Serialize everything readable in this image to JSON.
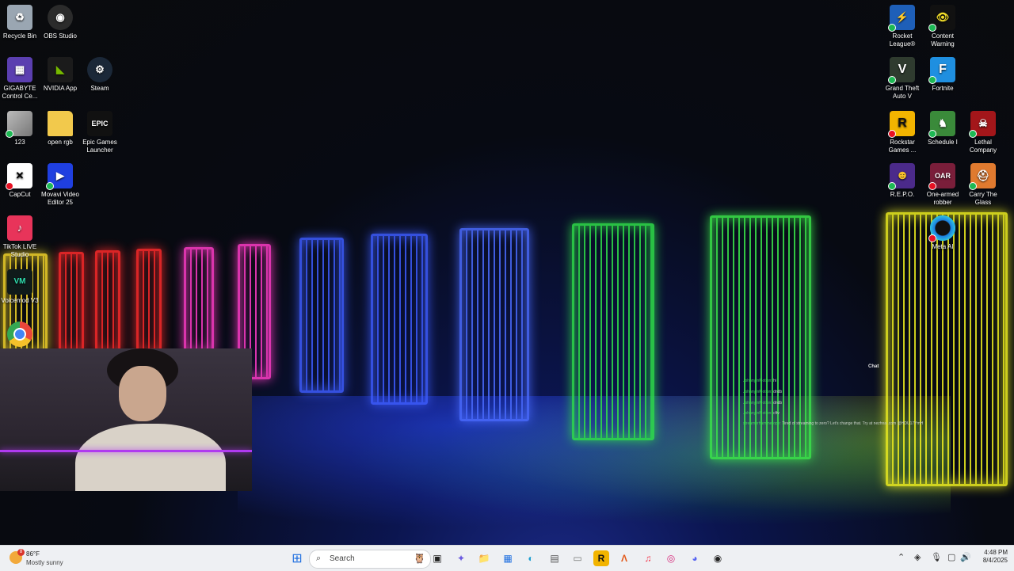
{
  "desktop_icons_left": [
    {
      "label": "Recycle Bin",
      "icon": "recycle-bin-icon",
      "color": "#9aa6b2",
      "glyph": "♻",
      "badge": ""
    },
    {
      "label": "OBS Studio",
      "icon": "obs-icon",
      "color": "#2b2b2b",
      "glyph": "◉",
      "badge": ""
    },
    {
      "label": "GIGABYTE Control Ce...",
      "icon": "gigabyte-icon",
      "color": "#5b3fb0",
      "glyph": "▦",
      "badge": ""
    },
    {
      "label": "NVIDIA App",
      "icon": "nvidia-icon",
      "color": "#1b1b1b",
      "glyph": "◣",
      "badge": ""
    },
    {
      "label": "Steam",
      "icon": "steam-icon",
      "color": "#1b2838",
      "glyph": "⚙",
      "badge": ""
    },
    {
      "label": "123",
      "icon": "image-file-icon",
      "color": "#8c8c8c",
      "glyph": "",
      "badge": "ok"
    },
    {
      "label": "open rgb",
      "icon": "folder-icon",
      "color": "#f2c94c",
      "glyph": "",
      "badge": ""
    },
    {
      "label": "Epic Games Launcher",
      "icon": "epic-games-icon",
      "color": "#111111",
      "glyph": "EPIC",
      "badge": ""
    },
    {
      "label": "CapCut",
      "icon": "capcut-icon",
      "color": "#ffffff",
      "glyph": "✕",
      "badge": "x"
    },
    {
      "label": "Movavi Video Editor 25",
      "icon": "movavi-icon",
      "color": "#1f3fe0",
      "glyph": "▶",
      "badge": "ok"
    },
    {
      "label": "TikTok LIVE Studio",
      "icon": "tiktok-icon",
      "color": "#e8345a",
      "glyph": "♪",
      "badge": ""
    },
    {
      "label": "Voicemod V3",
      "icon": "voicemod-icon",
      "color": "#0f1a1a",
      "glyph": "VM",
      "badge": ""
    },
    {
      "label": "",
      "icon": "chrome-icon",
      "color": "#e9463a",
      "glyph": "◎",
      "badge": ""
    }
  ],
  "desktop_icons_right": [
    {
      "label": "Rocket League®",
      "icon": "rocket-league-icon",
      "color": "#1e5fb8",
      "glyph": "⚡",
      "badge": "ok"
    },
    {
      "label": "Content Warning",
      "icon": "content-warning-icon",
      "color": "#111111",
      "glyph": "👁",
      "badge": "ok"
    },
    {
      "label": "Grand Theft Auto V",
      "icon": "gta-icon",
      "color": "#2f3b2f",
      "glyph": "V",
      "badge": "ok"
    },
    {
      "label": "Fortnite",
      "icon": "fortnite-icon",
      "color": "#1f8fe0",
      "glyph": "F",
      "badge": "ok"
    },
    {
      "label": "Rockstar Games ...",
      "icon": "rockstar-icon",
      "color": "#f2b400",
      "glyph": "R",
      "badge": "x"
    },
    {
      "label": "Schedule I",
      "icon": "schedule-icon",
      "color": "#3a8a3a",
      "glyph": "♞",
      "badge": "ok"
    },
    {
      "label": "Lethal Company",
      "icon": "lethal-company-icon",
      "color": "#a3161a",
      "glyph": "☠",
      "badge": "ok"
    },
    {
      "label": "R.E.P.O.",
      "icon": "repo-icon",
      "color": "#4b2a8a",
      "glyph": "☻",
      "badge": "ok"
    },
    {
      "label": "One-armed robber",
      "icon": "one-armed-robber-icon",
      "color": "#7a1e3a",
      "glyph": "OAR",
      "badge": "x"
    },
    {
      "label": "Carry The Glass",
      "icon": "carry-the-glass-icon",
      "color": "#e07a2f",
      "glyph": "⛑",
      "badge": "ok"
    },
    {
      "label": "Meta AI",
      "icon": "meta-ai-icon",
      "color": "#1c7fe0",
      "glyph": "◯",
      "badge": "x"
    }
  ],
  "chat_overlay": {
    "title": "Chat",
    "messages": [
      {
        "user": "JohnnyInMotion:",
        "text": "hi"
      },
      {
        "user": "JohnnyInMotion:",
        "text": "dndb"
      },
      {
        "user": "JohnnyInMotion:",
        "text": "dndb"
      },
      {
        "user": "JohnnyInMotion:",
        "text": "cftv"
      },
      {
        "user": "streamerhammerope:",
        "text": "Tired of streaming to zero? Let's change that. Try at nezhna .com @HDU17YmH"
      }
    ]
  },
  "taskbar": {
    "weather": {
      "temp": "86°F",
      "desc": "Mostly sunny",
      "alert": "8"
    },
    "search_placeholder": "Search",
    "clock_time": "4:48 PM",
    "clock_date": "8/4/2025",
    "apps": [
      {
        "icon": "start-icon",
        "glyph": "⊞",
        "color": "#1f6fe0"
      },
      {
        "icon": "widgets-icon",
        "glyph": "🦉",
        "color": "#8a6a3a"
      },
      {
        "icon": "task-view-icon",
        "glyph": "▣",
        "color": "#333333"
      },
      {
        "icon": "copilot-icon",
        "glyph": "✦",
        "color": "#6a5ae0"
      },
      {
        "icon": "file-explorer-icon",
        "glyph": "📁",
        "color": "#e8b33a"
      },
      {
        "icon": "microsoft-store-icon",
        "glyph": "▦",
        "color": "#1f6fe0"
      },
      {
        "icon": "edge-icon",
        "glyph": "◐",
        "color": "#1f9fd0"
      },
      {
        "icon": "notepad-icon",
        "glyph": "▤",
        "color": "#555555"
      },
      {
        "icon": "drive-icon",
        "glyph": "▭",
        "color": "#777777"
      },
      {
        "icon": "rockstar-launcher-icon",
        "glyph": "R",
        "color": "#f2b400"
      },
      {
        "icon": "app-a-icon",
        "glyph": "Λ",
        "color": "#e2591a"
      },
      {
        "icon": "itunes-icon",
        "glyph": "♫",
        "color": "#f2364a"
      },
      {
        "icon": "instagram-icon",
        "glyph": "◎",
        "color": "#d6297a"
      },
      {
        "icon": "discord-icon",
        "glyph": "◕",
        "color": "#5865f2"
      },
      {
        "icon": "obs-taskbar-icon",
        "glyph": "◉",
        "color": "#222222"
      }
    ],
    "tray": [
      {
        "icon": "chevron-up-icon",
        "glyph": "⌃"
      },
      {
        "icon": "network-status-icon",
        "glyph": "◈"
      },
      {
        "icon": "microphone-icon",
        "glyph": "🎙"
      },
      {
        "icon": "display-icon",
        "glyph": "▢"
      },
      {
        "icon": "speaker-icon",
        "glyph": "🔊"
      },
      {
        "icon": "notification-icon",
        "glyph": "🔔"
      }
    ]
  }
}
